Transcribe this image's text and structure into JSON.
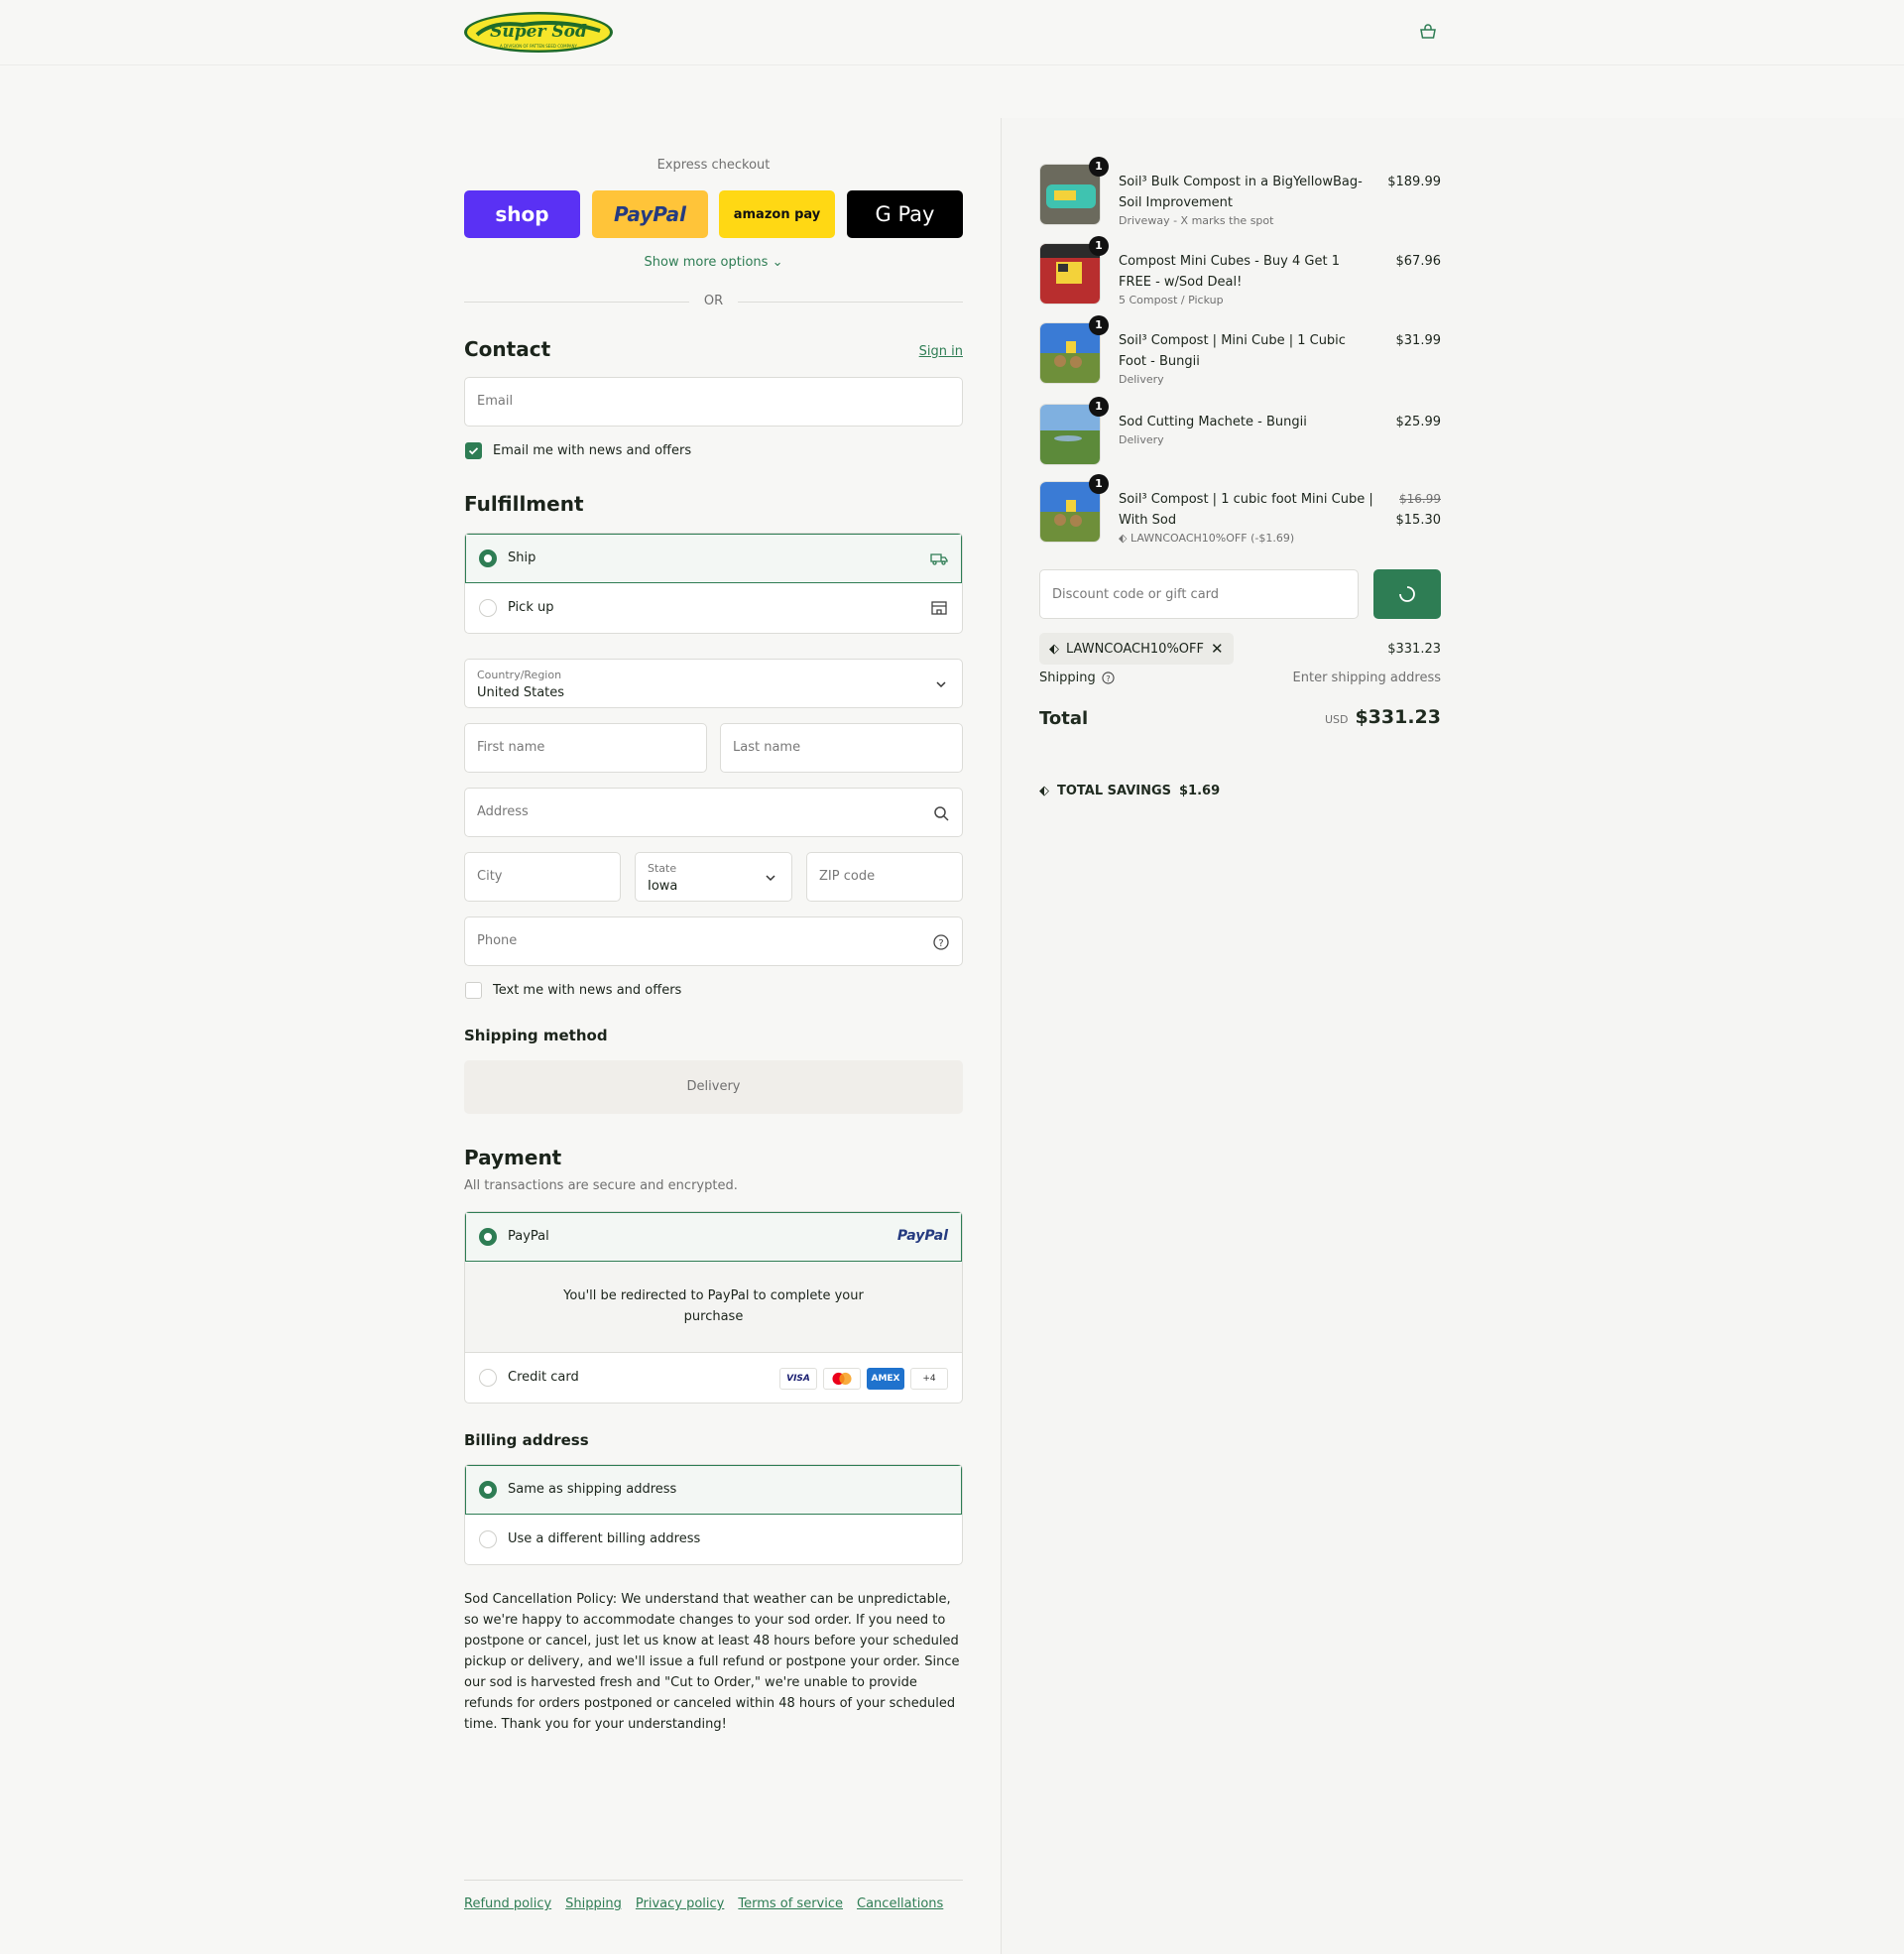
{
  "brand": {
    "name": "Super Sod",
    "tagline": "A DIVISION OF PATTEN SEED COMPANY",
    "logo_icon": "super-sod-logo"
  },
  "header": {
    "cart_icon": "shopping-bag-icon"
  },
  "express": {
    "title": "Express checkout",
    "buttons": {
      "shop": "shop",
      "paypal": "PayPal",
      "amazon": "amazon pay",
      "gpay": "G Pay"
    },
    "show_more": "Show more options",
    "or": "OR"
  },
  "contact": {
    "title": "Contact",
    "sign_in": "Sign in",
    "email_placeholder": "Email",
    "news_label": "Email me with news and offers",
    "news_checked": true
  },
  "fulfillment": {
    "title": "Fulfillment",
    "options": [
      {
        "label": "Ship",
        "selected": true,
        "icon": "truck-icon"
      },
      {
        "label": "Pick up",
        "selected": false,
        "icon": "store-icon"
      }
    ]
  },
  "address": {
    "country_label": "Country/Region",
    "country_value": "United States",
    "first_name": "First name",
    "last_name": "Last name",
    "address": "Address",
    "city": "City",
    "state_label": "State",
    "state_value": "Iowa",
    "zip": "ZIP code",
    "phone": "Phone",
    "text_label": "Text me with news and offers"
  },
  "shipping_method": {
    "title": "Shipping method",
    "value": "Delivery"
  },
  "payment": {
    "title": "Payment",
    "subtitle": "All transactions are secure and encrypted.",
    "paypal_label": "PayPal",
    "paypal_logo": "PayPal",
    "redirect_text": "You'll be redirected to PayPal to complete your purchase",
    "credit_label": "Credit card",
    "cards": [
      "VISA",
      "MC",
      "AMEX",
      "+4"
    ]
  },
  "billing": {
    "title": "Billing address",
    "options": [
      {
        "label": "Same as shipping address",
        "selected": true
      },
      {
        "label": "Use a different billing address",
        "selected": false
      }
    ]
  },
  "policy_text": "Sod Cancellation Policy: We understand that weather can be unpredictable, so we're happy to accommodate changes to your sod order. If you need to postpone or cancel, just let us know at least 48 hours before your scheduled pickup or delivery, and we'll issue a full refund or postpone your order. Since our sod is harvested fresh and \"Cut to Order,\" we're unable to provide refunds for orders postponed or canceled within 48 hours of your scheduled time. Thank you for your understanding!",
  "footer_links": [
    "Refund policy",
    "Shipping",
    "Privacy policy",
    "Terms of service",
    "Cancellations"
  ],
  "order": {
    "items": [
      {
        "qty": "1",
        "name": "Soil³ Bulk Compost in a BigYellowBag- Soil Improvement",
        "sub": "Driveway - X marks the spot",
        "price": "$189.99"
      },
      {
        "qty": "1",
        "name": "Compost Mini Cubes - Buy 4 Get 1 FREE - w/Sod Deal!",
        "sub": "5 Compost / Pickup",
        "price": "$67.96"
      },
      {
        "qty": "1",
        "name": "Soil³ Compost | Mini Cube | 1 Cubic Foot - Bungii",
        "sub": "Delivery",
        "price": "$31.99"
      },
      {
        "qty": "1",
        "name": "Sod Cutting Machete - Bungii",
        "sub": "Delivery",
        "price": "$25.99"
      },
      {
        "qty": "1",
        "name": "Soil³ Compost | 1 cubic foot Mini Cube | With Sod",
        "sub": "LAWNCOACH10%OFF (-$1.69)",
        "price_old": "$16.99",
        "price": "$15.30"
      }
    ],
    "discount_placeholder": "Discount code or gift card",
    "applied_code": "LAWNCOACH10%OFF",
    "subtotal": "$331.23",
    "shipping_label": "Shipping",
    "shipping_value": "Enter shipping address",
    "total_label": "Total",
    "currency": "USD",
    "total": "$331.23",
    "savings_label": "TOTAL SAVINGS",
    "savings_value": "$1.69"
  }
}
